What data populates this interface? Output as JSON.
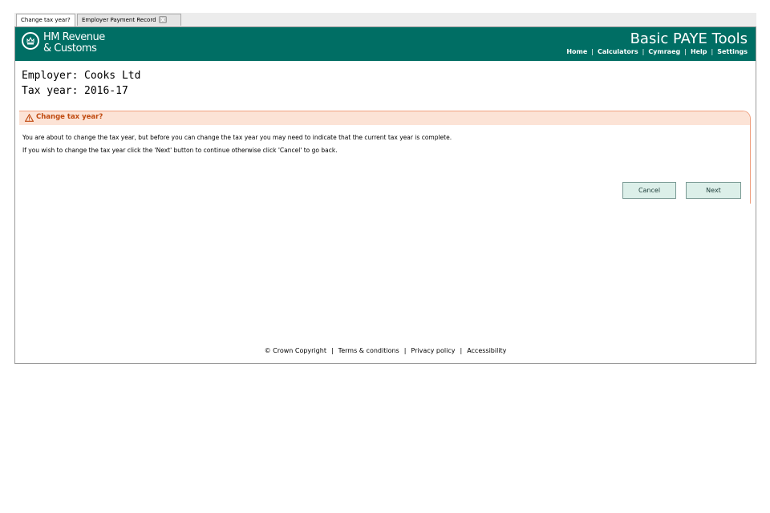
{
  "tabs": [
    {
      "label": "Change tax year?"
    },
    {
      "label": "Employer Payment Record"
    }
  ],
  "header": {
    "org_line1": "HM Revenue",
    "org_line2": "& Customs",
    "app_title": "Basic PAYE Tools",
    "nav": [
      "Home",
      "Calculators",
      "Cymraeg",
      "Help",
      "Settings"
    ]
  },
  "employer": {
    "label": "Employer:",
    "value": "Cooks Ltd"
  },
  "tax_year": {
    "label": "Tax year:",
    "value": "2016-17"
  },
  "panel": {
    "title": "Change tax year?",
    "message1": "You are about to change the tax year, but before you can change the tax year you may need to indicate that the current tax year is complete.",
    "message2": "If you wish to change the tax year click the 'Next' button to continue otherwise click 'Cancel' to go back."
  },
  "buttons": {
    "cancel": "Cancel",
    "next": "Next"
  },
  "footer": [
    "© Crown Copyright",
    "Terms & conditions",
    "Privacy policy",
    "Accessibility"
  ],
  "colors": {
    "header_bg": "#006e64",
    "warning": "#c04a10",
    "panel_head_bg": "#fce3d6"
  }
}
